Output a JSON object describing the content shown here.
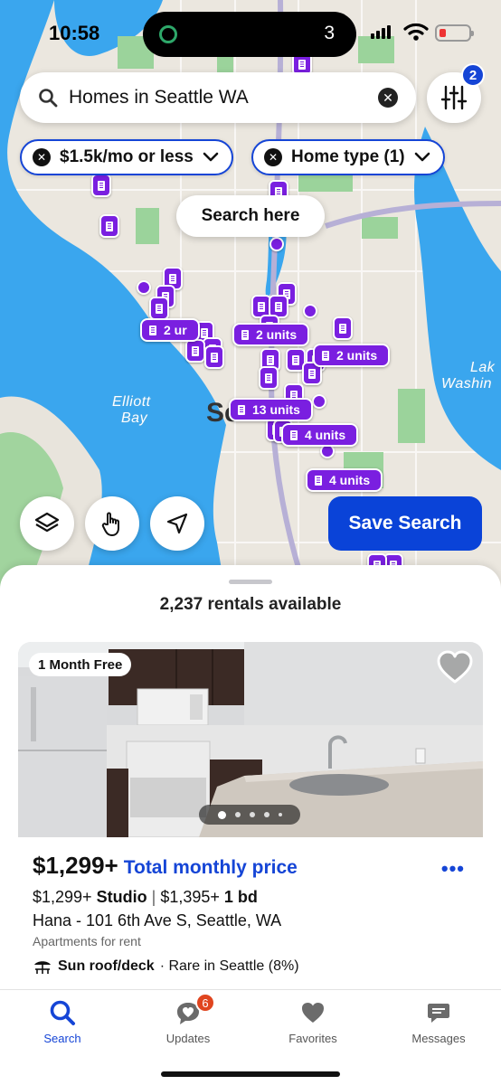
{
  "status_bar": {
    "time": "10:58",
    "activity_count": "3"
  },
  "search": {
    "query": "Homes in Seattle WA",
    "filter_badge": "2"
  },
  "filters": [
    {
      "label": "$1.5k/mo or less"
    },
    {
      "label": "Home type (1)"
    }
  ],
  "map": {
    "search_here_label": "Search here",
    "water_labels": [
      "Elliott",
      "Bay",
      "Lak",
      "Washin"
    ],
    "city_label": "Se",
    "clusters": [
      "2 ur",
      "2 units",
      "2 units",
      "13 units",
      "4 units",
      "4 units"
    ]
  },
  "controls": {
    "save_search_label": "Save Search"
  },
  "results": {
    "count_label": "2,237 rentals available"
  },
  "listing": {
    "promo": "1 Month Free",
    "price": "$1,299+",
    "price_note": "Total monthly price",
    "studio_price": "$1,299+",
    "studio_label": "Studio",
    "separator": "|",
    "bd_price": "$1,395+",
    "bd_label": "1 bd",
    "address": "Hana - 101 6th Ave S, Seattle, WA",
    "property_type": "Apartments for rent",
    "amenity": "Sun roof/deck",
    "amenity_note": "· Rare in Seattle (8%)"
  },
  "tabs": [
    {
      "label": "Search"
    },
    {
      "label": "Updates"
    },
    {
      "label": "Favorites"
    },
    {
      "label": "Messages"
    }
  ],
  "updates_badge": "6",
  "colors": {
    "accent": "#1545d6",
    "pin": "#7a1fe0",
    "water": "#3aa6ee",
    "land": "#e8e4dc",
    "park": "#9bd39b"
  }
}
